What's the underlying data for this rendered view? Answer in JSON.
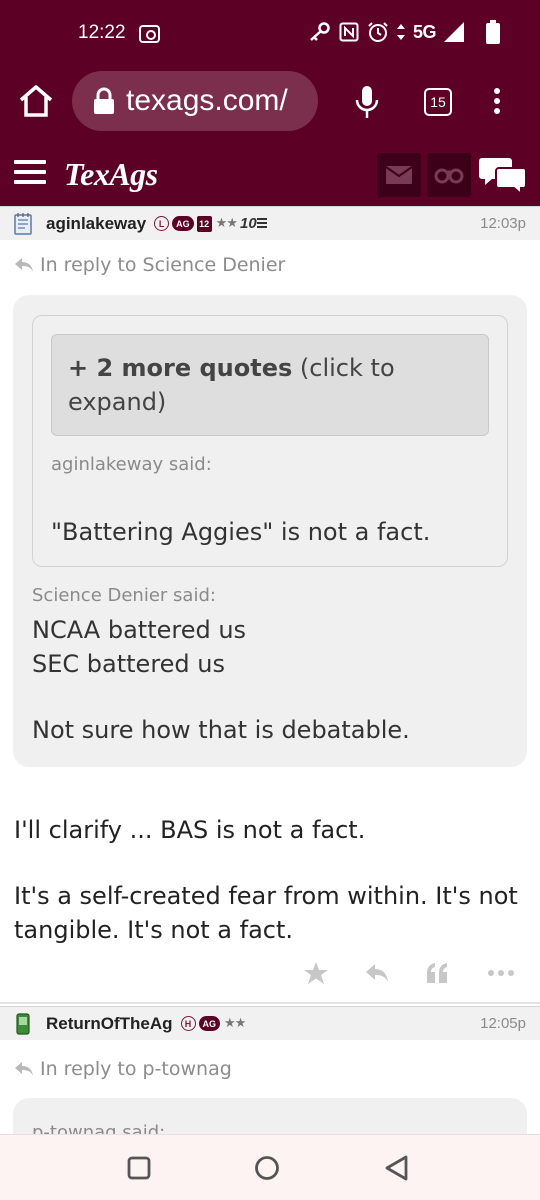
{
  "status": {
    "time": "12:22",
    "network": "5G",
    "icons": [
      "cast-icon",
      "key-icon",
      "nfc-icon",
      "alarm-icon",
      "data-arrows-icon",
      "signal-icon",
      "battery-icon"
    ]
  },
  "browser": {
    "url": "texags.com/",
    "tab_count": "15",
    "icons": [
      "home-icon",
      "lock-icon",
      "mic-icon",
      "more-vert-icon"
    ]
  },
  "site_header": {
    "logo": "TexAgs",
    "icons": [
      "hamburger-icon",
      "mail-icon",
      "binoculars-icon",
      "chat-icon"
    ]
  },
  "post1": {
    "username": "aginlakeway",
    "badge_letter": "L",
    "badge_ag": "AG",
    "badge_12": "12",
    "stars": "★★",
    "rank": "10",
    "time": "12:03p",
    "reply_to": "In reply to Science Denier",
    "more_quotes_bold": "+ 2 more quotes",
    "more_quotes_rest": " (click to expand)",
    "inner_said": "aginlakeway said:",
    "inner_quote": "\"Battering Aggies\" is not a fact.",
    "outer_said": "Science Denier said:",
    "outer_line1": "NCAA battered us",
    "outer_line2": "SEC battered us",
    "outer_line3": "Not sure how that is debatable.",
    "body_p1": "I'll clarify ... BAS is not a fact.",
    "body_p2": "It's a self-created fear from within. It's not tangible. It's not a fact.",
    "actions": [
      "star-icon",
      "reply-icon",
      "quote-icon",
      "more-icon"
    ]
  },
  "post2": {
    "username": "ReturnOfTheAg",
    "badge_letter": "H",
    "badge_ag": "AG",
    "stars": "★★",
    "time": "12:05p",
    "reply_to": "In reply to p-townag",
    "quote_said": "p-townag said:"
  },
  "colors": {
    "maroon": "#5c0025",
    "url_pill": "#7b2f4c",
    "quote_bg": "#f0f0f0"
  }
}
